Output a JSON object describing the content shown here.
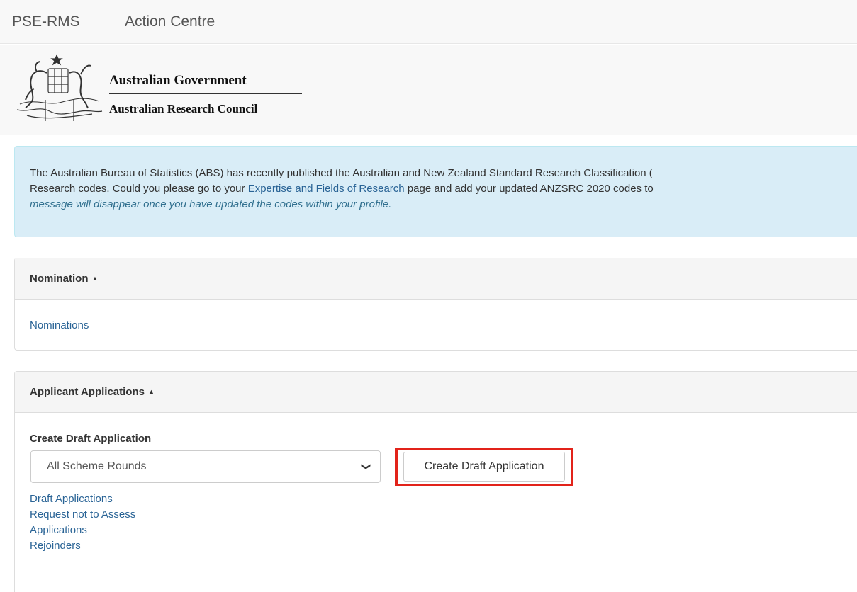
{
  "nav": {
    "brand": "PSE-RMS",
    "action_centre": "Action Centre"
  },
  "header": {
    "gov": "Australian Government",
    "council": "Australian Research Council"
  },
  "alert": {
    "line1": "The Australian Bureau of Statistics (ABS) has recently published the Australian and New Zealand Standard Research Classification (",
    "line2_pre": "Research codes. Could you please go to your ",
    "line2_link": "Expertise and Fields of Research",
    "line2_post": " page and add your updated ANZSRC 2020 codes to",
    "line3": "message will disappear once you have updated the codes within your profile."
  },
  "nomination_panel": {
    "heading": "Nomination",
    "links": [
      "Nominations"
    ]
  },
  "applications_panel": {
    "heading": "Applicant Applications",
    "create_label": "Create Draft Application",
    "select_value": "All Scheme Rounds",
    "create_button": "Create Draft Application",
    "links": [
      "Draft Applications",
      "Request not to Assess",
      "Applications",
      "Rejoinders"
    ]
  },
  "colors": {
    "alert_bg": "#d9edf7",
    "link": "#2a6496",
    "highlight": "#e2231a"
  }
}
